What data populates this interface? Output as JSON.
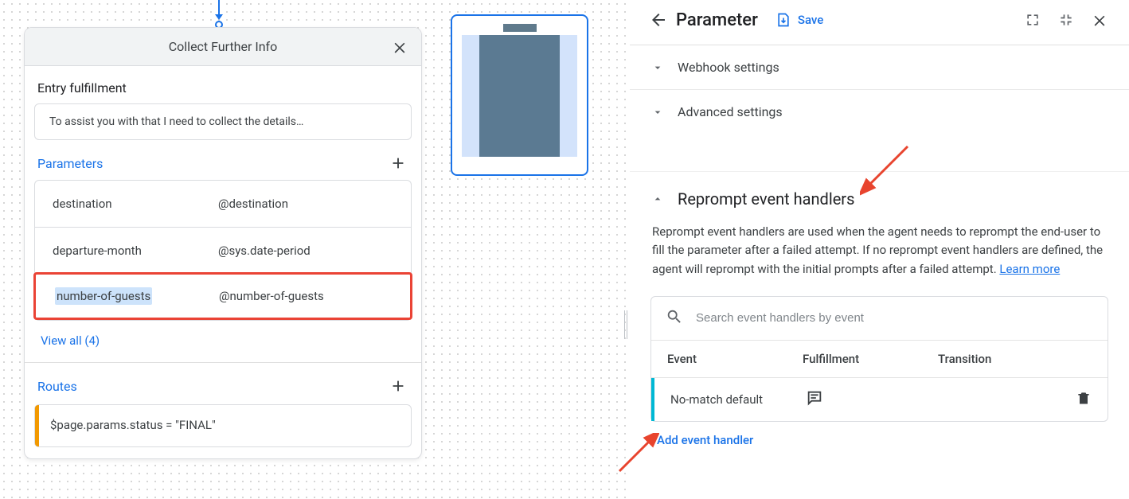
{
  "page": {
    "title": "Collect Further Info",
    "entry_fulfillment_label": "Entry fulfillment",
    "entry_fulfillment_text": "To assist you with that I need to collect the details…",
    "parameters_label": "Parameters",
    "parameters": [
      {
        "name": "destination",
        "entity": "@destination",
        "selected": false
      },
      {
        "name": "departure-month",
        "entity": "@sys.date-period",
        "selected": false
      },
      {
        "name": "number-of-guests",
        "entity": "@number-of-guests",
        "selected": true
      }
    ],
    "view_all_label": "View all (4)",
    "routes_label": "Routes",
    "route_condition": "$page.params.status = \"FINAL\""
  },
  "panel": {
    "title": "Parameter",
    "save_label": "Save",
    "sections": {
      "webhook": "Webhook settings",
      "advanced": "Advanced settings",
      "reprompt_title": "Reprompt event handlers",
      "reprompt_desc": "Reprompt event handlers are used when the agent needs to reprompt the end-user to fill the parameter after a failed attempt. If no reprompt event handlers are defined, the agent will reprompt with the initial prompts after a failed attempt. ",
      "learn_more": "Learn more"
    },
    "search_placeholder": "Search event handlers by event",
    "table": {
      "headers": {
        "event": "Event",
        "fulfillment": "Fulfillment",
        "transition": "Transition"
      },
      "rows": [
        {
          "event": "No-match default"
        }
      ]
    },
    "add_handler_label": "Add event handler"
  }
}
